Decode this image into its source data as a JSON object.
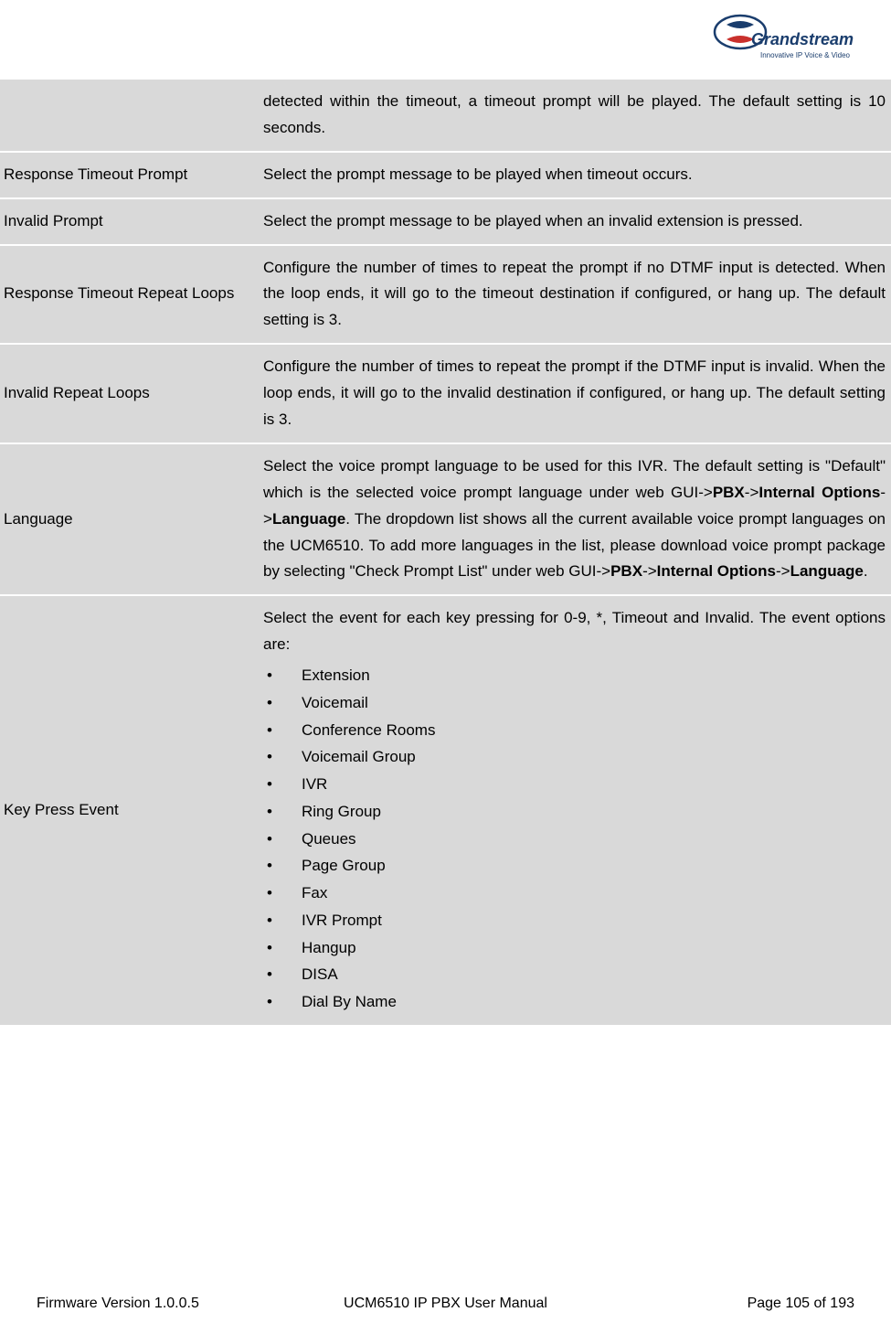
{
  "logo": {
    "brand_text": "Grandstream",
    "tagline": "Innovative IP Voice & Video"
  },
  "table": {
    "rows": [
      {
        "label": "",
        "desc_plain": "detected within the timeout, a timeout prompt will be played. The default setting is 10 seconds."
      },
      {
        "label": "Response Timeout Prompt",
        "desc_plain": "Select the prompt message to be played when timeout occurs."
      },
      {
        "label": "Invalid Prompt",
        "desc_plain": "Select the prompt message to be played when an invalid extension is pressed."
      },
      {
        "label": "Response Timeout Repeat Loops",
        "desc_plain": "Configure the number of times to repeat the prompt if no DTMF input is detected. When the loop ends, it will go to the timeout destination if configured, or hang up. The default setting is 3."
      },
      {
        "label": "Invalid Repeat Loops",
        "desc_plain": "Configure the number of times to repeat the prompt if the DTMF input is invalid. When the loop ends, it will go to the invalid destination if configured, or hang up. The default setting is 3."
      },
      {
        "label": "Language",
        "desc_rich": {
          "pre1": "Select the voice prompt language to be used for this IVR. The default setting is \"Default\" which is the selected voice prompt language under web GUI->",
          "b1": "PBX",
          "mid1": "->",
          "b2": "Internal Options",
          "mid2": "->",
          "b3": "Language",
          "post1": ". The dropdown list shows all the current available voice prompt languages on the UCM6510. To add more languages in the list, please download voice prompt package by selecting \"Check Prompt List\" under web GUI->",
          "b4": "PBX",
          "mid3": "->",
          "b5": "Internal Options",
          "mid4": "->",
          "b6": "Language",
          "post2": "."
        }
      },
      {
        "label": "Key Press Event",
        "desc_intro": "Select the event for each key pressing for 0-9, *, Timeout and Invalid. The event options are:",
        "bullets": [
          "Extension",
          "Voicemail",
          "Conference Rooms",
          "Voicemail Group",
          "IVR",
          "Ring Group",
          "Queues",
          "Page Group",
          "Fax",
          "IVR Prompt",
          "Hangup",
          "DISA",
          "Dial By Name"
        ]
      }
    ]
  },
  "footer": {
    "left": "Firmware Version 1.0.0.5",
    "center": "UCM6510 IP PBX User Manual",
    "right": "Page 105 of 193"
  }
}
